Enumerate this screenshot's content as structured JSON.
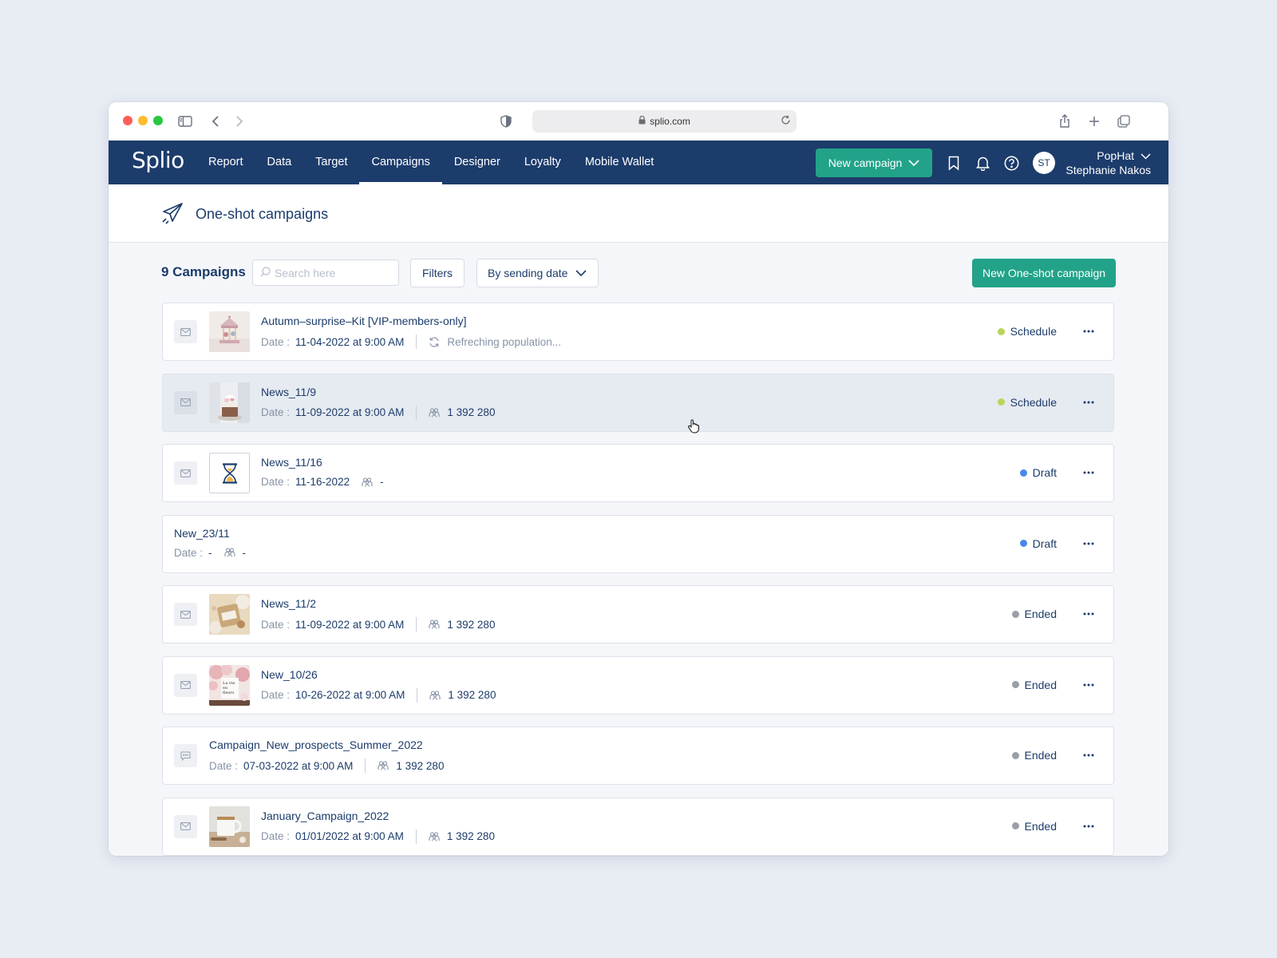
{
  "browser": {
    "url": "splio.com"
  },
  "app": {
    "logo": "Splio",
    "nav": [
      {
        "label": "Report",
        "active": false
      },
      {
        "label": "Data",
        "active": false
      },
      {
        "label": "Target",
        "active": false
      },
      {
        "label": "Campaigns",
        "active": true
      },
      {
        "label": "Designer",
        "active": false
      },
      {
        "label": "Loyalty",
        "active": false
      },
      {
        "label": "Mobile Wallet",
        "active": false
      }
    ],
    "new_campaign_label": "New campaign",
    "avatar_initials": "ST",
    "account_org": "PopHat",
    "account_user": "Stephanie Nakos"
  },
  "page": {
    "title": "One-shot campaigns",
    "count_label": "9 Campaigns",
    "search_placeholder": "Search here",
    "filters_label": "Filters",
    "sort_label": "By sending date",
    "new_oneshot_label": "New One-shot campaign"
  },
  "colors": {
    "navbar": "#1c3c6b",
    "accent": "#22a389",
    "status_schedule": "#b9d55a",
    "status_draft": "#4a86e8",
    "status_ended": "#9a9fa8"
  },
  "campaigns": [
    {
      "name": "Autumn–surprise–Kit [VIP-members-only]",
      "date_label": "Date :",
      "date": "11-04-2022 at 9:00 AM",
      "population": "Refreching population...",
      "refreshing": true,
      "status": "Schedule",
      "status_color": "#b9d55a",
      "channel": "email",
      "thumb": "carousel",
      "hover": false
    },
    {
      "name": "News_11/9",
      "date_label": "Date :",
      "date": "11-09-2022 at 9:00 AM",
      "population": "1 392 280",
      "refreshing": false,
      "status": "Schedule",
      "status_color": "#b9d55a",
      "channel": "email",
      "thumb": "cake",
      "hover": true
    },
    {
      "name": "News_11/16",
      "date_label": "Date :",
      "date": "11-16-2022",
      "population": "-",
      "refreshing": false,
      "status": "Draft",
      "status_color": "#4a86e8",
      "channel": "email",
      "thumb": "pending",
      "hover": false
    },
    {
      "name": "New_23/11",
      "date_label": "Date :",
      "date": "-",
      "population": "-",
      "refreshing": false,
      "status": "Draft",
      "status_color": "#4a86e8",
      "channel": "none",
      "thumb": "none",
      "hover": false
    },
    {
      "name": "News_11/2",
      "date_label": "Date :",
      "date": "11-09-2022 at 9:00 AM",
      "population": "1 392 280",
      "refreshing": false,
      "status": "Ended",
      "status_color": "#9a9fa8",
      "channel": "email",
      "thumb": "gift",
      "hover": false
    },
    {
      "name": "New_10/26",
      "date_label": "Date :",
      "date": "10-26-2022 at 9:00 AM",
      "population": "1 392 280",
      "refreshing": false,
      "status": "Ended",
      "status_color": "#9a9fa8",
      "channel": "email",
      "thumb": "flowers",
      "hover": false
    },
    {
      "name": "Campaign_New_prospects_Summer_2022",
      "date_label": "Date :",
      "date": "07-03-2022 at 9:00 AM",
      "population": "1 392 280",
      "refreshing": false,
      "status": "Ended",
      "status_color": "#9a9fa8",
      "channel": "sms",
      "thumb": "none",
      "hover": false
    },
    {
      "name": "January_Campaign_2022",
      "date_label": "Date :",
      "date": "01/01/2022 at 9:00 AM",
      "population": "1 392 280",
      "refreshing": false,
      "status": "Ended",
      "status_color": "#9a9fa8",
      "channel": "email",
      "thumb": "mug",
      "hover": false
    }
  ]
}
